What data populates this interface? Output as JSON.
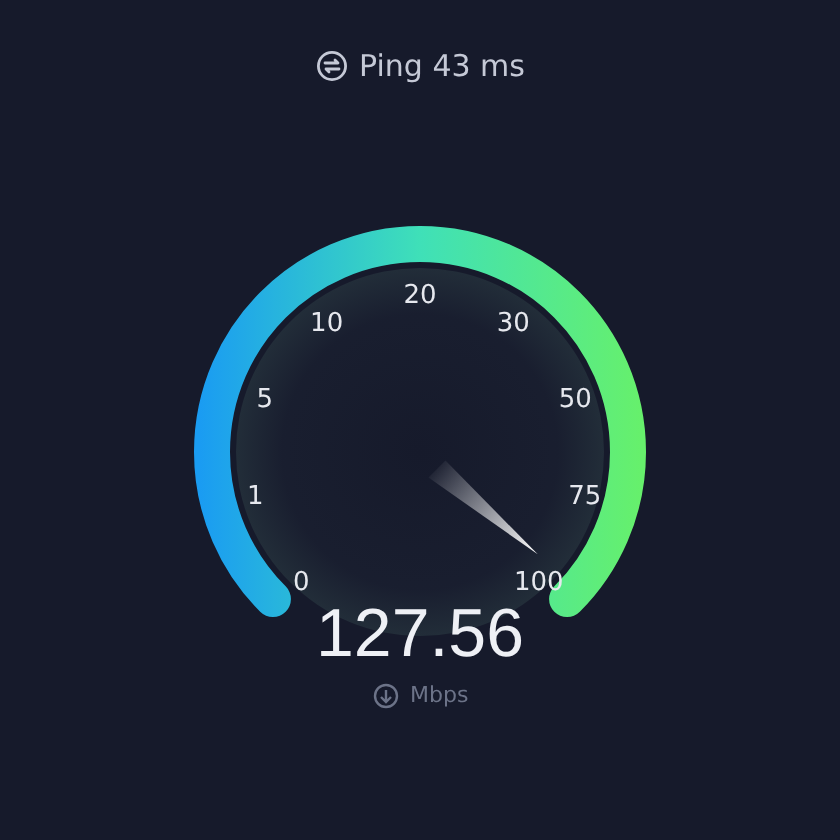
{
  "ping": {
    "label": "Ping 43 ms"
  },
  "gauge": {
    "ticks": [
      "0",
      "1",
      "5",
      "10",
      "20",
      "30",
      "50",
      "75",
      "100"
    ],
    "reading": "127.56",
    "unit": "Mbps"
  }
}
